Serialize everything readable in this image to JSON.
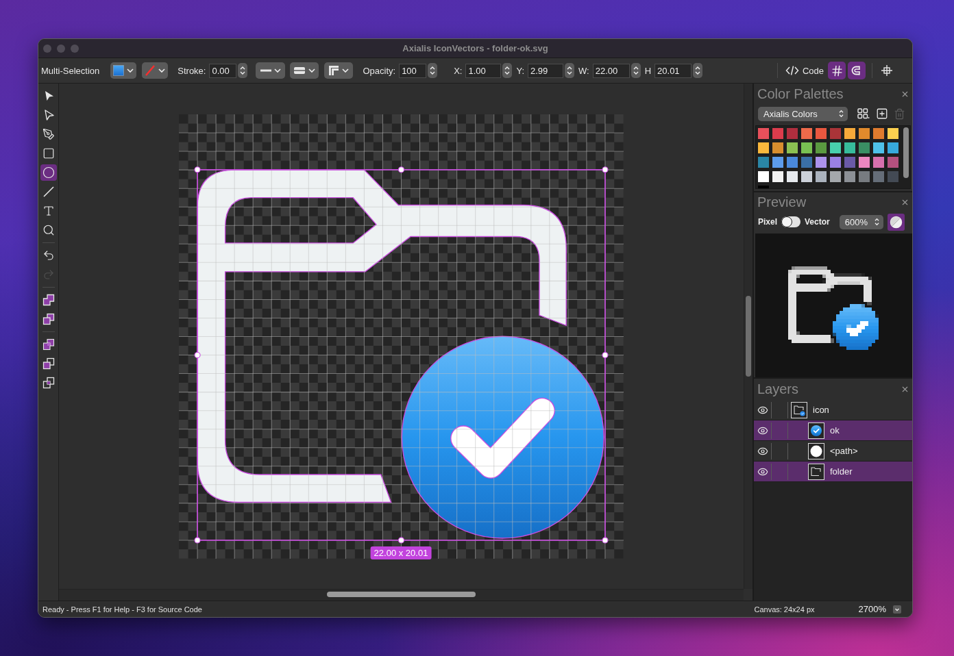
{
  "window": {
    "title": "Axialis IconVectors - folder-ok.svg"
  },
  "toolbar": {
    "mode": "Multi-Selection",
    "stroke": {
      "label": "Stroke:",
      "value": "0.00"
    },
    "opacity": {
      "label": "Opacity:",
      "value": "100"
    },
    "geometry": [
      {
        "label": "X:",
        "value": "1.00"
      },
      {
        "label": "Y:",
        "value": "2.99"
      },
      {
        "label": "W:",
        "value": "22.00"
      },
      {
        "label": "H",
        "value": "20.01"
      }
    ],
    "code_button": "Code",
    "toggles": [
      {
        "on": true
      },
      {
        "on": true
      }
    ]
  },
  "tool_groups": [
    {
      "tools": [
        {
          "selected": false,
          "disabled": false
        },
        {
          "selected": false,
          "disabled": false
        },
        {
          "selected": false,
          "disabled": false
        },
        {
          "selected": false,
          "disabled": false
        },
        {
          "selected": true,
          "disabled": false
        },
        {
          "selected": false,
          "disabled": false
        },
        {
          "selected": false,
          "disabled": false
        },
        {
          "selected": false,
          "disabled": false
        }
      ]
    },
    {
      "tools": [
        {
          "selected": false,
          "disabled": false
        },
        {
          "selected": false,
          "disabled": true
        }
      ]
    },
    {
      "tools": [
        {
          "selected": false,
          "disabled": false
        },
        {
          "selected": false,
          "disabled": false
        }
      ]
    },
    {
      "tools": [
        {
          "selected": false,
          "disabled": false
        },
        {
          "selected": false,
          "disabled": false
        },
        {
          "selected": false,
          "disabled": false
        }
      ]
    }
  ],
  "canvas": {
    "size_label": "22.00 x 20.01"
  },
  "color_palettes": {
    "title": "Color Palettes",
    "palette": "Axialis Colors",
    "delete_disabled": true,
    "swatches": [
      {
        "color": "#e8505b"
      },
      {
        "color": "#dc3c4c"
      },
      {
        "color": "#b02e3e"
      },
      {
        "color": "#ee6a4a"
      },
      {
        "color": "#e9573f"
      },
      {
        "color": "#aa3438"
      },
      {
        "color": "#f6a93a"
      },
      {
        "color": "#e18a2c"
      },
      {
        "color": "#e07b2e"
      },
      {
        "color": "#fcd04f"
      },
      {
        "color": "#fbb83c"
      },
      {
        "color": "#d88e2e"
      },
      {
        "color": "#8cc152"
      },
      {
        "color": "#79c152"
      },
      {
        "color": "#5a9a40"
      },
      {
        "color": "#48cfad"
      },
      {
        "color": "#37bc9b"
      },
      {
        "color": "#3a8f64"
      },
      {
        "color": "#4fc1e9"
      },
      {
        "color": "#37a9dc"
      },
      {
        "color": "#2a86a6"
      },
      {
        "color": "#5d9cec"
      },
      {
        "color": "#4a89dc"
      },
      {
        "color": "#3a6fa6"
      },
      {
        "color": "#ac92ec"
      },
      {
        "color": "#9a80e4"
      },
      {
        "color": "#6a5aa8"
      },
      {
        "color": "#ec87c0"
      },
      {
        "color": "#d770ad"
      },
      {
        "color": "#b4507e"
      },
      {
        "color": "#ffffff"
      },
      {
        "color": "#f2f2f2"
      },
      {
        "color": "#e6e9ed"
      },
      {
        "color": "#ccd1d9"
      },
      {
        "color": "#aab2bd"
      },
      {
        "color": "#a4a8ac"
      },
      {
        "color": "#8c9096"
      },
      {
        "color": "#777b80"
      },
      {
        "color": "#656d78"
      },
      {
        "color": "#434a54"
      },
      {
        "color": "#000000"
      }
    ]
  },
  "preview": {
    "title": "Preview",
    "pixel_label": "Pixel",
    "vector_label": "Vector",
    "vector_on": false,
    "zoom": "600%",
    "contrast_on": true
  },
  "layers": {
    "title": "Layers",
    "rows": [
      {
        "name": "icon",
        "kind": "group",
        "selected": false,
        "children": [
          {
            "name": "ok",
            "kind": "badge",
            "selected": true
          },
          {
            "name": "<path>",
            "kind": "disc",
            "selected": false
          },
          {
            "name": "folder",
            "kind": "folder",
            "selected": true
          }
        ]
      }
    ]
  },
  "status_bar": {
    "message": "Ready - Press F1 for Help - F3 for Source Code",
    "canvas_size": "Canvas: 24x24 px",
    "zoom": "2700%"
  }
}
